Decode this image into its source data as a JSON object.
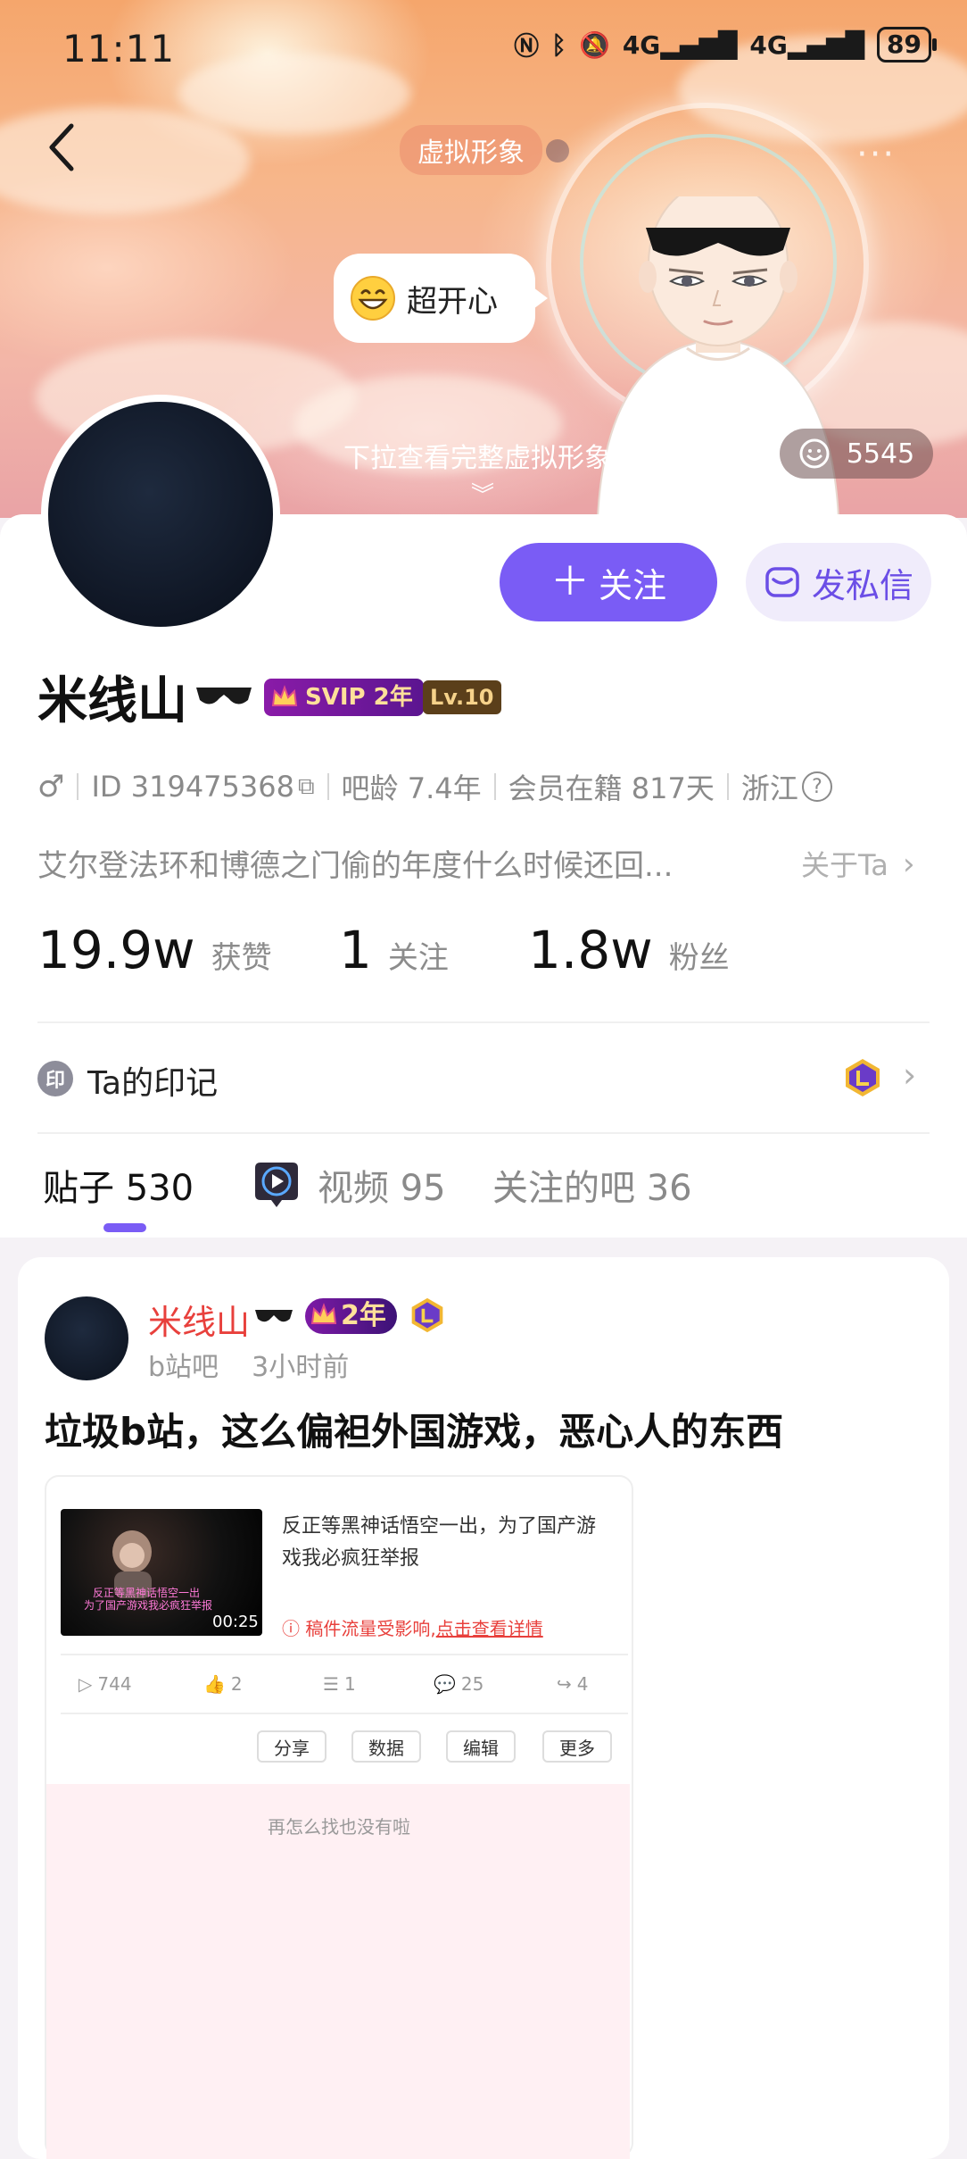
{
  "status_bar": {
    "time": "11:11",
    "network_1": "4G",
    "network_2": "4G",
    "battery": "89"
  },
  "hero": {
    "avatar_tag": "虚拟形象",
    "mood": "超开心",
    "pull_hint": "下拉查看完整虚拟形象",
    "likes_count": "5545"
  },
  "profile": {
    "username": "米线山",
    "svip_label": "SVIP 2年",
    "level_label": "Lv.10",
    "follow_label": "关注",
    "message_label": "发私信",
    "id_text": "ID 319475368",
    "bar_age": "吧龄 7.4年",
    "member_days": "会员在籍 817天",
    "region": "浙江",
    "bio": "艾尔登法环和博德之门偷的年度什么时候还回...",
    "about_label": "关于Ta",
    "stats": [
      {
        "value": "19.9w",
        "label": "获赞"
      },
      {
        "value": "1",
        "label": "关注"
      },
      {
        "value": "1.8w",
        "label": "粉丝"
      }
    ],
    "imprint_label": "Ta的印记",
    "imprint_icon_char": "印"
  },
  "tabs": [
    {
      "label": "贴子 530"
    },
    {
      "label": "视频 95"
    },
    {
      "label": "关注的吧 36"
    }
  ],
  "post": {
    "username": "米线山",
    "year_badge": "2年",
    "forum": "b站吧",
    "time": "3小时前",
    "title": "垃圾b站，这么偏袒外国游戏，恶心人的东西",
    "embed": {
      "description": "反正等黑神话悟空一出，为了国产游戏我必疯狂举报",
      "warning_prefix": "稿件流量受影响,",
      "warning_link": "点击查看详情",
      "duration": "00:25",
      "thumb_line1": "反正等黑神话悟空一出",
      "thumb_line2": "为了国产游戏我必疯狂举报",
      "stats": {
        "plays": "744",
        "likes": "2",
        "danmaku": "1",
        "comments": "25",
        "shares": "4"
      },
      "buttons": [
        "分享",
        "数据",
        "编辑",
        "更多"
      ],
      "empty_text": "再怎么找也没有啦"
    }
  },
  "colors": {
    "accent": "#7a5cf5",
    "username_red": "#e8403c",
    "svip_purple": "#8a1ba8"
  }
}
